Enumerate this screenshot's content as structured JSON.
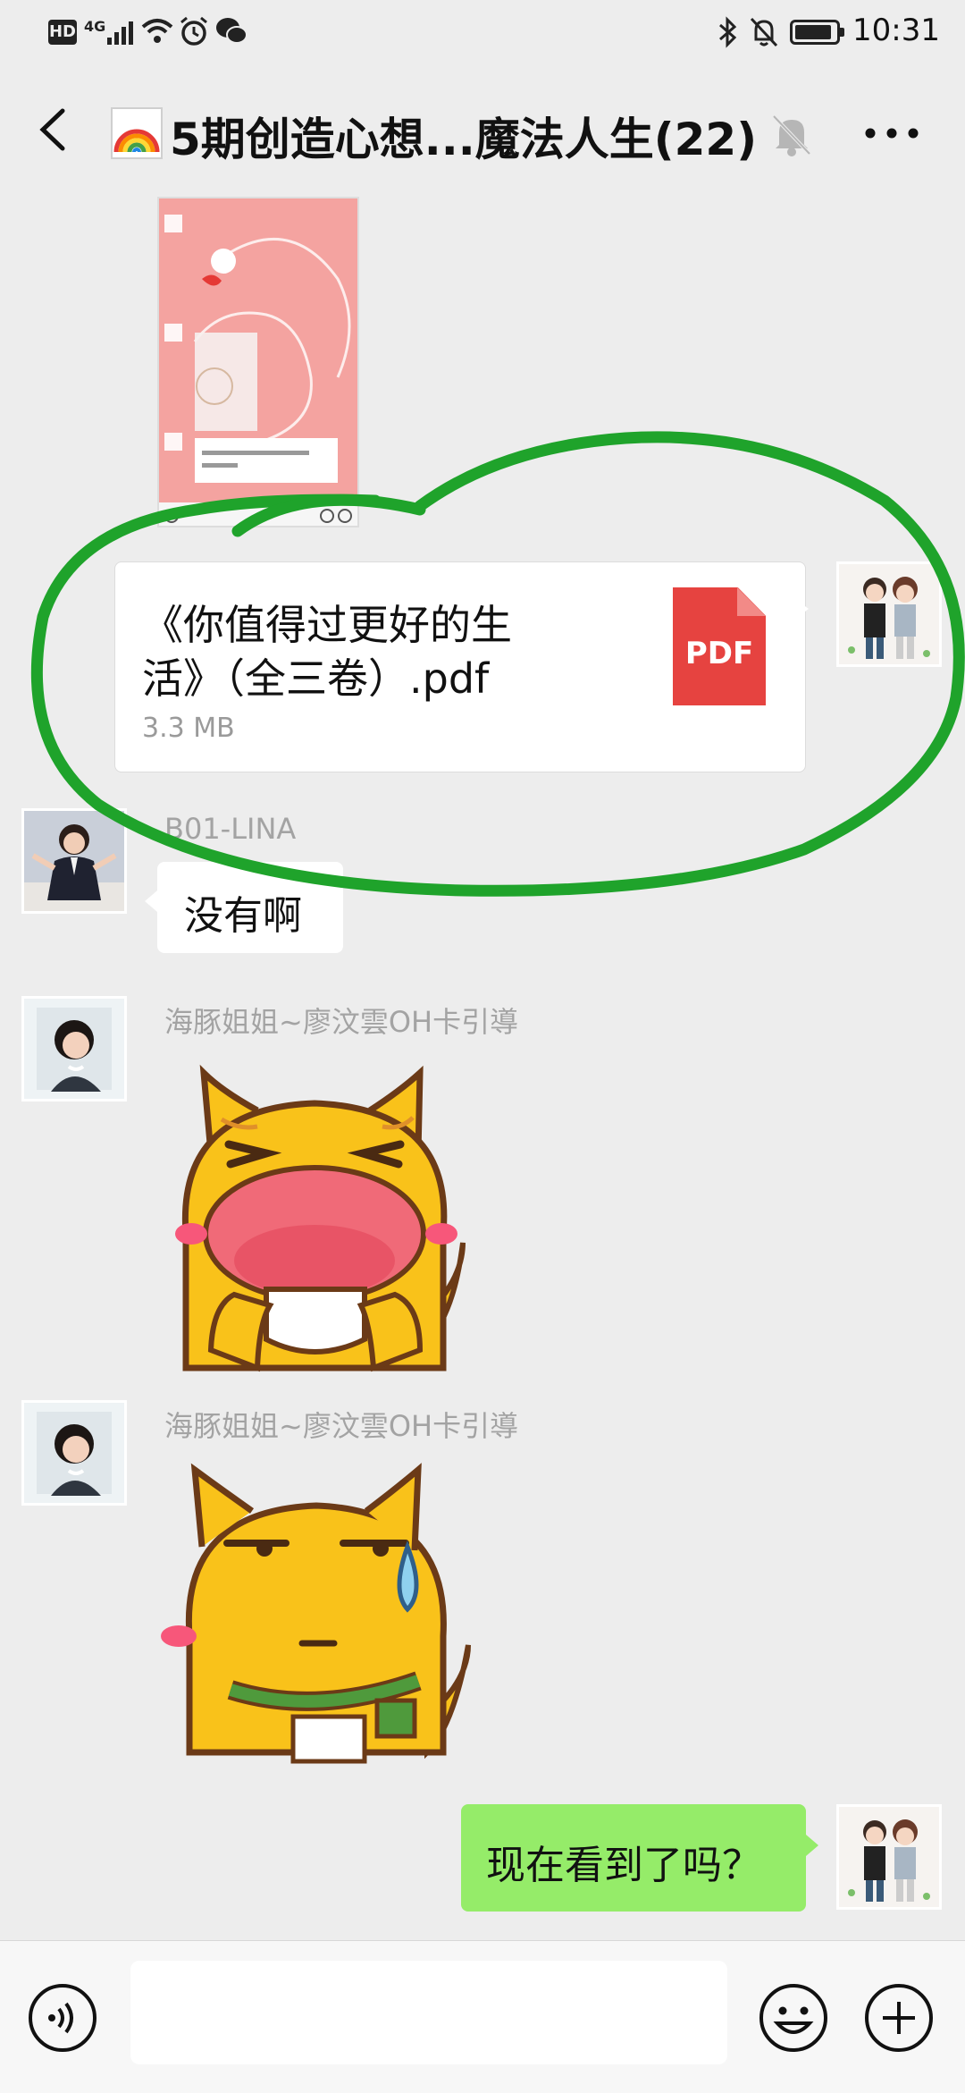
{
  "status_bar": {
    "hd": "HD",
    "network": "4G",
    "time": "10:31",
    "battery_level_percent": 90,
    "icons": [
      "signal-icon",
      "wifi-icon",
      "alarm-icon",
      "wechat-icon",
      "bluetooth-icon",
      "mute-icon",
      "battery-icon"
    ]
  },
  "header": {
    "title": "5期创造心想...魔法人生(22)",
    "title_emoji": "🌈",
    "icons": [
      "back-arrow-icon",
      "muted-bell-icon",
      "more-dots-icon"
    ]
  },
  "messages": {
    "file": {
      "name": "《你值得过更好的生活》（全三卷）.pdf",
      "name_line1": "《你值得过更好的生",
      "name_line2": "活》（全三卷）.pdf",
      "size": "3.3 MB",
      "file_type": "PDF"
    },
    "m1": {
      "sender": "B01-LINA",
      "text": "没有啊"
    },
    "m2": {
      "sender": "海豚姐姐~廖汶雲OH卡引導",
      "sticker": "laughing-cat-sticker"
    },
    "m3": {
      "sender": "海豚姐姐~廖汶雲OH卡引導",
      "sticker": "sweating-cat-sticker"
    },
    "m4": {
      "text": "现在看到了吗？"
    }
  },
  "colors": {
    "background": "#ededed",
    "my_bubble": "#95ec69",
    "pdf_red": "#e64340",
    "highlight_green": "#1fa32b",
    "cat_yellow": "#f9c21a"
  },
  "input_bar": {
    "placeholder": "",
    "icons": [
      "voice-icon",
      "emoji-icon",
      "plus-icon"
    ]
  }
}
